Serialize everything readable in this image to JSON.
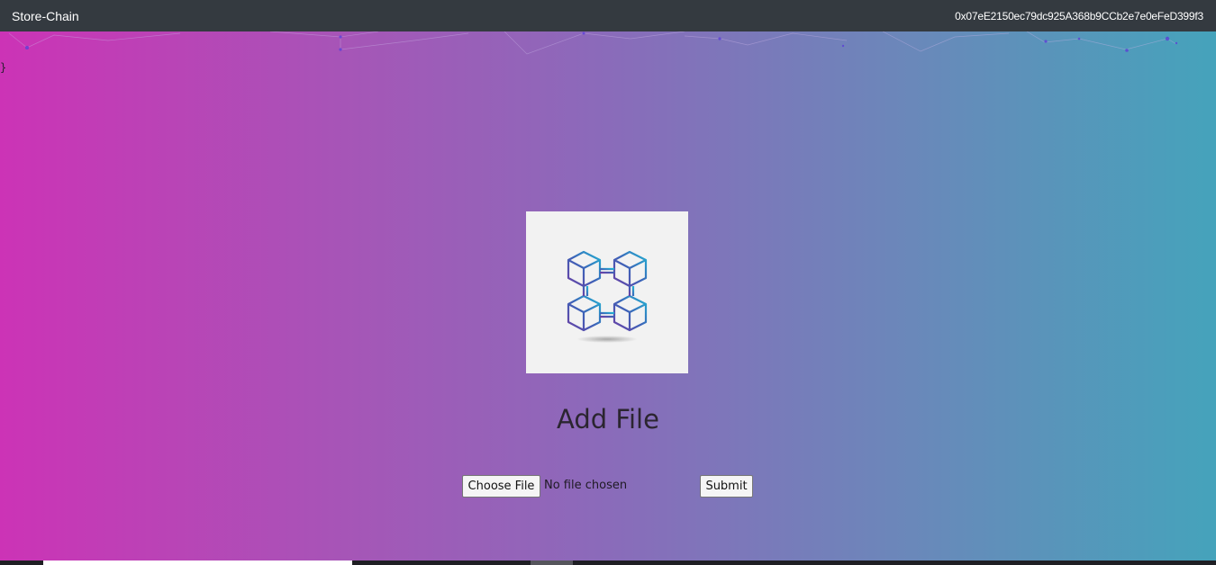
{
  "navbar": {
    "brand": "Store-Chain",
    "account_address": "0x07eE2150ec79dc925A368b9CCb2e7e0eFeD399f3"
  },
  "stray_text": "}",
  "main": {
    "logo_icon": "blockchain-cubes-icon",
    "title": "Add File",
    "file_input": {
      "button_label": "Choose File",
      "status_text": "No file chosen"
    },
    "submit_label": "Submit"
  },
  "colors": {
    "navbar_bg": "#343a40",
    "gradient_start": "#cc33b6",
    "gradient_end": "#45a3bb",
    "logo_box_bg": "#f2f2f2"
  }
}
